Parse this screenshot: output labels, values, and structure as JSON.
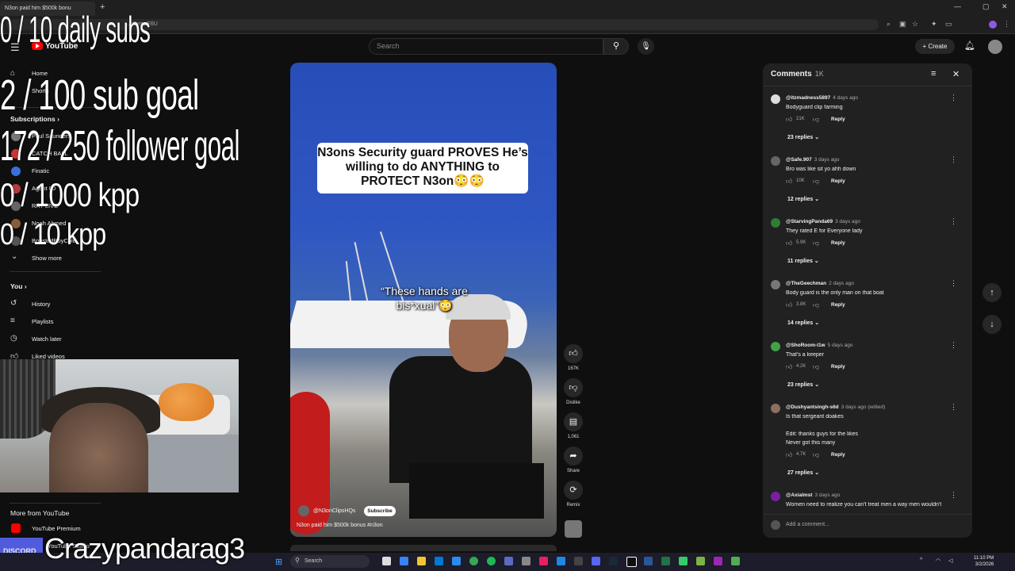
{
  "browser": {
    "tab_title": "N3on paid him $500k bonu",
    "new_tab": "+",
    "url": "...cZemeE6U"
  },
  "header": {
    "logo_text": "YouTube",
    "search_placeholder": "Search",
    "create_label": "Create"
  },
  "sidebar": {
    "home": "Home",
    "shorts": "Shorts",
    "subscriptions": "Subscriptions",
    "subs": [
      "Paul Saunders",
      "CATCH BALL",
      "Finatic",
      "Agent 00",
      "RAY LIVE",
      "Noah Ahmed",
      "BoostedBoyCole"
    ],
    "show_more": "Show more",
    "you": "You",
    "history": "History",
    "playlists": "Playlists",
    "watch_later": "Watch later",
    "liked": "Liked videos",
    "more_from": "More from YouTube",
    "premium": "YouTube Premium",
    "studio": "YouTube Studio"
  },
  "overlays": {
    "daily_subs": "0 / 10 daily subs",
    "sub_goal": "2 / 100 sub goal",
    "follower_goal": "172 / 250 follower goal",
    "kpp_1000": "0 / 1000 kpp",
    "kpp_10": "0 / 10 kpp",
    "streamer_name": "Crazypandarag3",
    "discord": "DISCORD"
  },
  "video": {
    "caption": "N3ons Security guard PROVES He’s willing to do ANYTHING to PROTECT N3on😳😳",
    "mid_text": "“These hands are bis*xual”😳",
    "channel": "@N3onClipsHQs",
    "subscribe": "Subscribe",
    "title": "N3on paid him $500k bonus #n3on"
  },
  "actions": {
    "likes": "167K",
    "dislike": "Dislike",
    "comments": "1,061",
    "share": "Share",
    "remix": "Remix"
  },
  "comments": {
    "title": "Comments",
    "count": "1K",
    "reply_label": "Reply",
    "add_placeholder": "Add a comment...",
    "items": [
      {
        "user": "@itzmadness5897",
        "ago": "4 days ago",
        "text": [
          "Bodyguard clip farming"
        ],
        "likes": "21K",
        "replies": "23 replies"
      },
      {
        "user": "@Safe.907",
        "ago": "3 days ago",
        "text": [
          "Bro was like sit yo ahh down"
        ],
        "likes": "10K",
        "replies": "12 replies"
      },
      {
        "user": "@StarvingPanda69",
        "ago": "3 days ago",
        "text": [
          "They rated E for Everyone lady"
        ],
        "likes": "5.9K",
        "replies": "11 replies"
      },
      {
        "user": "@TheGeechman",
        "ago": "2 days ago",
        "text": [
          "Body guard is the only man on that boat"
        ],
        "likes": "3.8K",
        "replies": "14 replies"
      },
      {
        "user": "@ShoRoom-i1w",
        "ago": "5 days ago",
        "text": [
          "That's a keeper"
        ],
        "likes": "4.2K",
        "replies": "23 replies"
      },
      {
        "user": "@Dushyantsingh-s6d",
        "ago": "3 days ago (edited)",
        "text": [
          "Is that sergeant doakes",
          "",
          "Edit: thanks guys for the likes",
          "Never got this many"
        ],
        "likes": "4.7K",
        "replies": "27 replies"
      },
      {
        "user": "@Axialmst",
        "ago": "3 days ago",
        "text": [
          "Women need to realize you can't treat men a way men wouldn't"
        ],
        "likes": "",
        "replies": ""
      }
    ]
  },
  "taskbar": {
    "search": "Search",
    "time": "11:10 PM",
    "date": "3/2/2026"
  },
  "colors": {
    "background": "#0f0f0f",
    "panel": "#212121",
    "accent_red": "#ff0000",
    "taskbar": "#1c1c2a"
  }
}
